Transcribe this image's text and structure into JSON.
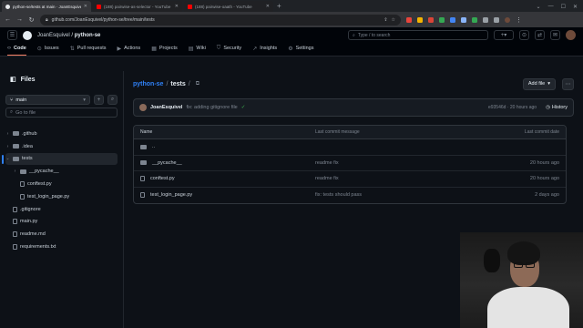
{
  "browser": {
    "tabs": [
      {
        "title": "python-se/tests at main · JoanEsquivel/python-se",
        "favicon": "github-icon",
        "active": true
      },
      {
        "title": "(188) pairwise-as-selector - YouTube",
        "favicon": "youtube-icon",
        "active": false
      },
      {
        "title": "(188) pairwise-oaath - YouTube",
        "favicon": "youtube-icon",
        "active": false
      }
    ],
    "new_tab": "+",
    "url": "github.com/JoanEsquivel/python-se/tree/main/tests",
    "extension_colors": [
      "#e8453c",
      "#f4b400",
      "#db4437",
      "#34a853",
      "#4285f4",
      "#8ab4f8"
    ]
  },
  "github": {
    "owner": "JoanEsquivel",
    "repo": "python-se",
    "separator": "/",
    "search_placeholder": "Type / to search",
    "new_label": "+",
    "tabs": [
      {
        "label": "Code",
        "icon": "code-icon",
        "selected": true
      },
      {
        "label": "Issues",
        "icon": "issue-icon",
        "selected": false
      },
      {
        "label": "Pull requests",
        "icon": "pull-request-icon",
        "selected": false
      },
      {
        "label": "Actions",
        "icon": "actions-icon",
        "selected": false
      },
      {
        "label": "Projects",
        "icon": "projects-icon",
        "selected": false
      },
      {
        "label": "Wiki",
        "icon": "wiki-icon",
        "selected": false
      },
      {
        "label": "Security",
        "icon": "shield-icon",
        "selected": false
      },
      {
        "label": "Insights",
        "icon": "graph-icon",
        "selected": false
      },
      {
        "label": "Settings",
        "icon": "gear-icon",
        "selected": false
      }
    ]
  },
  "sidebar": {
    "title": "Files",
    "branch": "main",
    "go_to_file_placeholder": "Go to file",
    "tree": [
      {
        "name": ".github",
        "type": "folder",
        "depth": 0,
        "selected": false
      },
      {
        "name": ".idea",
        "type": "folder",
        "depth": 0,
        "selected": false
      },
      {
        "name": "tests",
        "type": "folder",
        "depth": 0,
        "selected": true,
        "expanded": true
      },
      {
        "name": "__pycache__",
        "type": "folder",
        "depth": 1,
        "selected": false
      },
      {
        "name": "conftest.py",
        "type": "file",
        "depth": 1,
        "selected": false
      },
      {
        "name": "test_login_page.py",
        "type": "file",
        "depth": 1,
        "selected": false
      },
      {
        "name": ".gitignore",
        "type": "file",
        "depth": 0,
        "selected": false
      },
      {
        "name": "main.py",
        "type": "file",
        "depth": 0,
        "selected": false
      },
      {
        "name": "readme.md",
        "type": "file",
        "depth": 0,
        "selected": false
      },
      {
        "name": "requirements.txt",
        "type": "file",
        "depth": 0,
        "selected": false
      }
    ]
  },
  "main": {
    "breadcrumb_repo": "python-se",
    "breadcrumb_sep1": "/",
    "breadcrumb_current": "tests",
    "breadcrumb_sep2": "/",
    "add_file_label": "Add file",
    "commit": {
      "author": "JoanEsquivel",
      "message": "fix: adding gitignore file",
      "meta": "e93546d · 20 hours ago",
      "history_label": "History"
    },
    "table_headers": {
      "name": "Name",
      "message": "Last commit message",
      "date": "Last commit date"
    },
    "rows": [
      {
        "name": "..",
        "type": "parent",
        "message": "",
        "date": ""
      },
      {
        "name": "__pycache__",
        "type": "folder",
        "message": "readme fix",
        "date": "20 hours ago"
      },
      {
        "name": "conftest.py",
        "type": "file",
        "message": "readme fix",
        "date": "20 hours ago"
      },
      {
        "name": "test_login_page.py",
        "type": "file",
        "message": "fix: tests should pass",
        "date": "2 days ago"
      }
    ]
  }
}
